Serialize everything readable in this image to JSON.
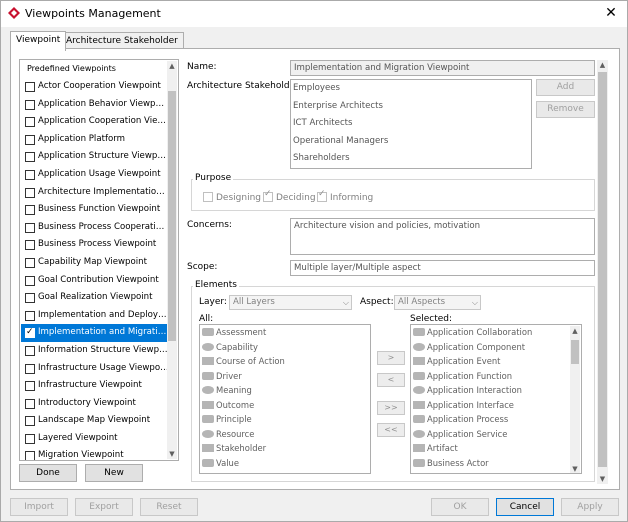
{
  "window": {
    "title": "Viewpoints Management",
    "close_glyph": "✕"
  },
  "tabs": [
    {
      "label": "Viewpoint"
    },
    {
      "label": "Architecture Stakeholder"
    }
  ],
  "predefined": {
    "legend": "Predefined Viewpoints",
    "items": [
      {
        "label": "Actor Cooperation Viewpoint",
        "checked": false
      },
      {
        "label": "Application Behavior Viewpoint",
        "checked": false
      },
      {
        "label": "Application Cooperation Viewp...",
        "checked": false
      },
      {
        "label": "Application Platform",
        "checked": false
      },
      {
        "label": "Application Structure Viewpoint",
        "checked": false
      },
      {
        "label": "Application Usage Viewpoint",
        "checked": false
      },
      {
        "label": "Architecture Implementation a...",
        "checked": false
      },
      {
        "label": "Business Function Viewpoint",
        "checked": false
      },
      {
        "label": "Business Process Cooperation ...",
        "checked": false
      },
      {
        "label": "Business Process Viewpoint",
        "checked": false
      },
      {
        "label": "Capability Map Viewpoint",
        "checked": false
      },
      {
        "label": "Goal Contribution Viewpoint",
        "checked": false
      },
      {
        "label": "Goal Realization Viewpoint",
        "checked": false
      },
      {
        "label": "Implementation and Deployme...",
        "checked": false
      },
      {
        "label": "Implementation and Migration ...",
        "checked": true
      },
      {
        "label": "Information Structure Viewpoint",
        "checked": false
      },
      {
        "label": "Infrastructure Usage Viewpoint",
        "checked": false
      },
      {
        "label": "Infrastructure Viewpoint",
        "checked": false
      },
      {
        "label": "Introductory Viewpoint",
        "checked": false
      },
      {
        "label": "Landscape Map Viewpoint",
        "checked": false
      },
      {
        "label": "Layered Viewpoint",
        "checked": false
      },
      {
        "label": "Migration Viewpoint",
        "checked": false
      }
    ],
    "done_label": "Done",
    "new_label": "New"
  },
  "detail": {
    "name_label": "Name:",
    "name_value": "Implementation and Migration Viewpoint",
    "stakeholders_label": "Architecture Stakeholders:",
    "stakeholders": [
      "Employees",
      "Enterprise Architects",
      "ICT Architects",
      "Operational Managers",
      "Shareholders"
    ],
    "add_label": "Add",
    "remove_label": "Remove",
    "purpose_label": "Purpose",
    "purpose_options": [
      {
        "label": "Designing",
        "checked": false
      },
      {
        "label": "Deciding",
        "checked": true
      },
      {
        "label": "Informing",
        "checked": true
      }
    ],
    "concerns_label": "Concerns:",
    "concerns_value": "Architecture vision and policies, motivation",
    "scope_label": "Scope:",
    "scope_value": "Multiple layer/Multiple aspect"
  },
  "elements": {
    "legend": "Elements",
    "layer_label": "Layer:",
    "layer_value": "All Layers",
    "aspect_label": "Aspect:",
    "aspect_value": "All Aspects",
    "all_label": "All:",
    "selected_label": "Selected:",
    "all_items": [
      "Assessment",
      "Capability",
      "Course of Action",
      "Driver",
      "Meaning",
      "Outcome",
      "Principle",
      "Resource",
      "Stakeholder",
      "Value"
    ],
    "selected_items": [
      "Application Collaboration",
      "Application Component",
      "Application Event",
      "Application Function",
      "Application Interaction",
      "Application Interface",
      "Application Process",
      "Application Service",
      "Artifact",
      "Business Actor"
    ],
    "move_right": ">",
    "move_left": "<",
    "move_all_right": ">>",
    "move_all_left": "<<"
  },
  "footer": {
    "import_label": "Import",
    "export_label": "Export",
    "reset_label": "Reset",
    "ok_label": "OK",
    "cancel_label": "Cancel",
    "apply_label": "Apply"
  },
  "colors": {
    "selection": "#0078d7",
    "app_icon": "#c8102e"
  }
}
